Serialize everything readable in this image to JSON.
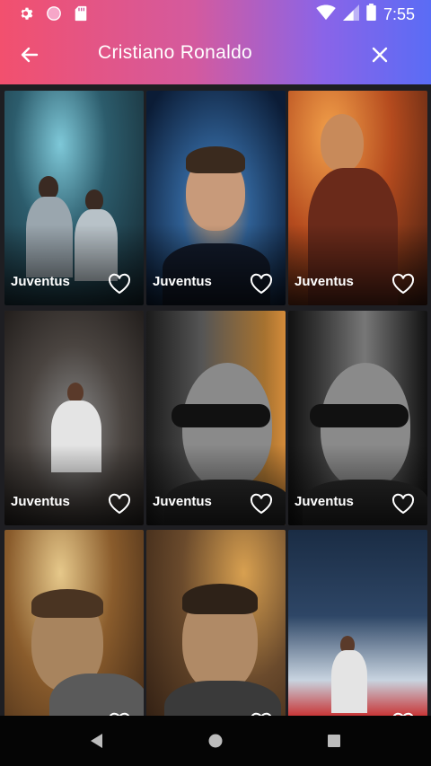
{
  "status_bar": {
    "time": "7:55",
    "left_icons": [
      "gear-icon",
      "circle-indicator-icon",
      "sd-card-icon"
    ],
    "right_icons": [
      "wifi-icon",
      "signal-icon",
      "battery-icon"
    ]
  },
  "app_bar": {
    "title": "Cristiano Ronaldo",
    "back_icon": "arrow-left-icon",
    "close_icon": "close-icon"
  },
  "colors": {
    "header_gradient_start": "#f2506e",
    "header_gradient_end": "#5a6cf5",
    "background": "#1e1e22"
  },
  "wallpapers": [
    {
      "label": "Juventus",
      "favorite": false
    },
    {
      "label": "Juventus",
      "favorite": false
    },
    {
      "label": "Juventus",
      "favorite": false
    },
    {
      "label": "Juventus",
      "favorite": false
    },
    {
      "label": "Juventus",
      "favorite": false
    },
    {
      "label": "Juventus",
      "favorite": false
    },
    {
      "label": "",
      "favorite": false
    },
    {
      "label": "",
      "favorite": false
    },
    {
      "label": "",
      "favorite": false
    }
  ],
  "nav_bar": {
    "buttons": [
      "back-triangle-icon",
      "home-circle-icon",
      "recents-square-icon"
    ]
  }
}
